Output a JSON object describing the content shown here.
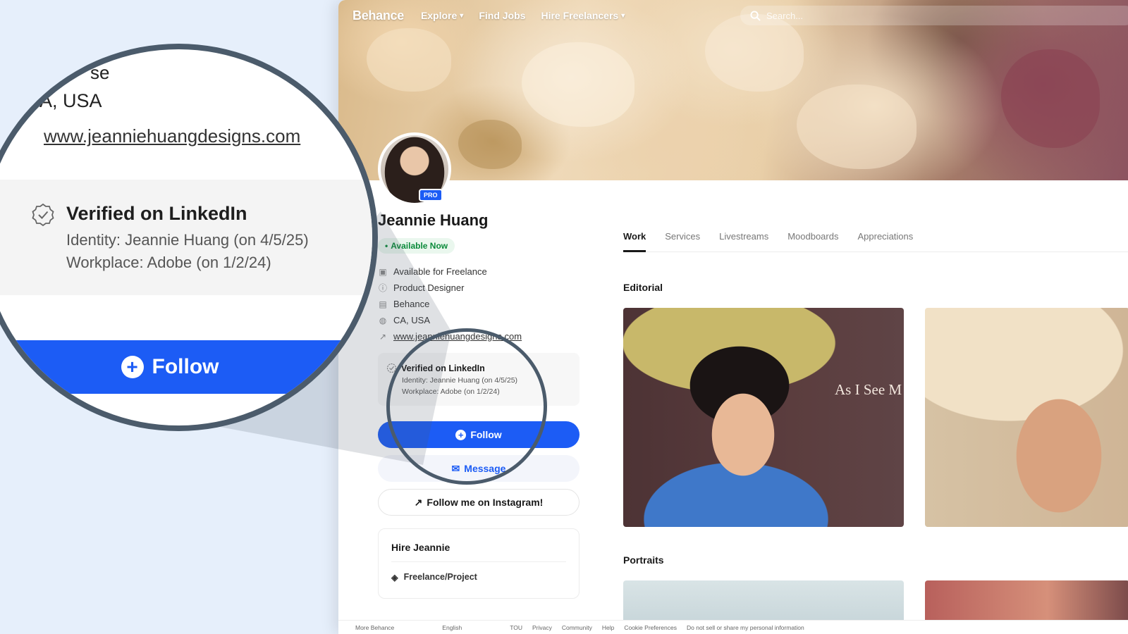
{
  "nav": {
    "brand": "Behance",
    "links": [
      {
        "label": "Explore",
        "has_dropdown": true
      },
      {
        "label": "Find Jobs",
        "has_dropdown": false
      },
      {
        "label": "Hire Freelancers",
        "has_dropdown": true
      }
    ],
    "search_placeholder": "Search..."
  },
  "profile": {
    "name": "Jeannie Huang",
    "badge": "PRO",
    "status": "Available Now",
    "details": [
      {
        "icon": "briefcase-icon",
        "text": "Available for Freelance"
      },
      {
        "icon": "info-icon",
        "text": "Product Designer"
      },
      {
        "icon": "building-icon",
        "text": "Behance"
      },
      {
        "icon": "globe-icon",
        "text": "CA, USA"
      },
      {
        "icon": "link-icon",
        "text": "www.jeanniehuangdesigns.com"
      }
    ],
    "verification": {
      "title": "Verified on LinkedIn",
      "identity": "Identity: Jeannie Huang (on 4/5/25)",
      "workplace": "Workplace: Adobe (on 1/2/24)"
    },
    "buttons": {
      "follow": "Follow",
      "message": "Message",
      "instagram": "Follow me on Instagram!"
    },
    "hire": {
      "title": "Hire Jeannie",
      "item": "Freelance/Project"
    }
  },
  "tabs": [
    {
      "label": "Work",
      "active": true
    },
    {
      "label": "Services",
      "active": false
    },
    {
      "label": "Livestreams",
      "active": false
    },
    {
      "label": "Moodboards",
      "active": false
    },
    {
      "label": "Appreciations",
      "active": false
    }
  ],
  "sections": {
    "editorial": "Editorial",
    "portraits": "Portraits",
    "editorial_overlay_text": "As I See M"
  },
  "footer": {
    "items": [
      "More Behance",
      "English",
      "TOU",
      "Privacy",
      "Community",
      "Help",
      "Cookie Preferences",
      "Do not sell or share my personal information"
    ]
  },
  "magnifier": {
    "company_fragment": "se",
    "location_fragment": "A, USA",
    "url": "www.jeanniehuangdesigns.com",
    "verified_title": "Verified on LinkedIn",
    "identity": "Identity: Jeannie Huang (on 4/5/25)",
    "workplace": "Workplace: Adobe (on 1/2/24)",
    "follow": "Follow"
  },
  "colors": {
    "accent": "#1c5cf5",
    "available": "#0a8a3a",
    "page_background": "#e6effb",
    "magnifier_ring": "#4b5b6b"
  }
}
